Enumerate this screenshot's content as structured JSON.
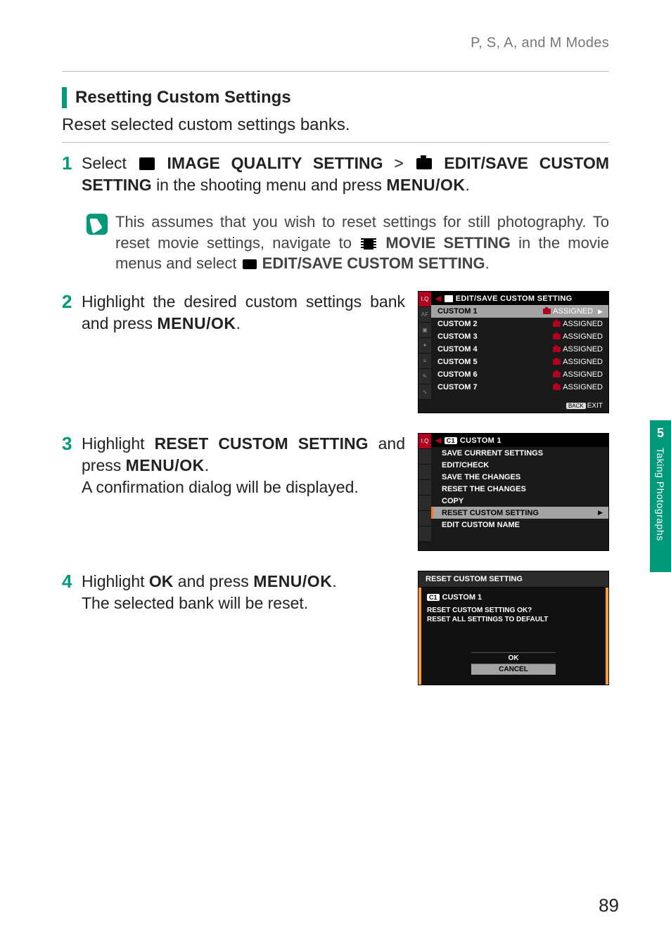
{
  "running_head": "P, S, A, and M Modes",
  "section_title": "Resetting Custom Settings",
  "intro": "Reset selected custom settings banks.",
  "side_tab": {
    "chapter": "5",
    "label": "Taking Photographs"
  },
  "page_number": "89",
  "step1": {
    "pre": "Select ",
    "iq_label": "IMAGE QUALITY SETTING",
    "gt": " > ",
    "edit_label": "EDIT/SAVE CUSTOM SETTING",
    "tail1": " in the shooting menu and press ",
    "menuok": "MENU/OK",
    "period": "."
  },
  "note": {
    "text1": "This assumes that you wish to reset settings for still photography. To reset movie settings, navigate to ",
    "movie_setting": "MOVIE SETTING",
    "text2": " in the movie menus and select ",
    "edit_save": "EDIT/SAVE CUSTOM SETTING",
    "period": "."
  },
  "step2": {
    "text1": "Highlight the desired custom settings bank and press ",
    "menuok": "MENU/OK",
    "period": "."
  },
  "step3": {
    "text1": "Highlight ",
    "reset": "RESET CUSTOM SETTING",
    "text2": " and press ",
    "menuok": "MENU/OK",
    "period": ".",
    "text3": "A confirmation dialog will be displayed."
  },
  "step4": {
    "text1": "Highlight ",
    "ok": "OK",
    "text2": " and press ",
    "menuok": "MENU/OK",
    "period": ".",
    "text3": "The selected bank will be reset."
  },
  "screen1": {
    "title": "EDIT/SAVE CUSTOM SETTING",
    "rows": [
      {
        "name": "CUSTOM 1",
        "status": "ASSIGNED",
        "selected": true
      },
      {
        "name": "CUSTOM 2",
        "status": "ASSIGNED"
      },
      {
        "name": "CUSTOM 3",
        "status": "ASSIGNED"
      },
      {
        "name": "CUSTOM 4",
        "status": "ASSIGNED"
      },
      {
        "name": "CUSTOM 5",
        "status": "ASSIGNED"
      },
      {
        "name": "CUSTOM 6",
        "status": "ASSIGNED"
      },
      {
        "name": "CUSTOM 7",
        "status": "ASSIGNED"
      }
    ],
    "footer_back": "BACK",
    "footer_exit": "EXIT"
  },
  "screen2": {
    "title_badge": "C1",
    "title": "CUSTOM 1",
    "rows": [
      {
        "label": "SAVE CURRENT SETTINGS"
      },
      {
        "label": "EDIT/CHECK"
      },
      {
        "label": "SAVE THE CHANGES"
      },
      {
        "label": "RESET THE CHANGES"
      },
      {
        "label": "COPY"
      },
      {
        "label": "RESET CUSTOM SETTING",
        "selected": true
      },
      {
        "label": "EDIT CUSTOM NAME"
      }
    ]
  },
  "dialog": {
    "header": "RESET CUSTOM SETTING",
    "badge": "C1",
    "name": "CUSTOM 1",
    "q1": "RESET CUSTOM SETTING OK?",
    "q2": "RESET ALL SETTINGS TO DEFAULT",
    "ok": "OK",
    "cancel": "CANCEL"
  }
}
